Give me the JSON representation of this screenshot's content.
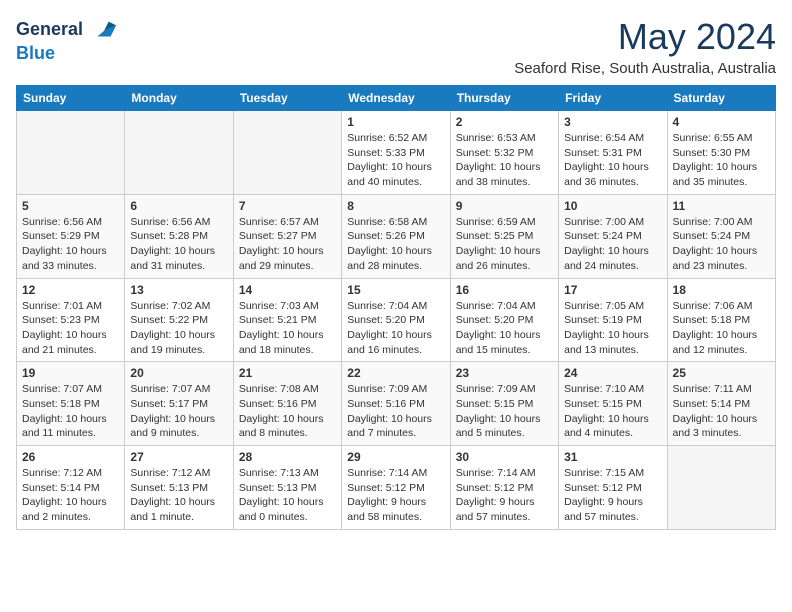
{
  "logo": {
    "line1": "General",
    "line2": "Blue"
  },
  "header": {
    "month_year": "May 2024",
    "location": "Seaford Rise, South Australia, Australia"
  },
  "days_of_week": [
    "Sunday",
    "Monday",
    "Tuesday",
    "Wednesday",
    "Thursday",
    "Friday",
    "Saturday"
  ],
  "weeks": [
    [
      {
        "day": "",
        "info": ""
      },
      {
        "day": "",
        "info": ""
      },
      {
        "day": "",
        "info": ""
      },
      {
        "day": "1",
        "info": "Sunrise: 6:52 AM\nSunset: 5:33 PM\nDaylight: 10 hours\nand 40 minutes."
      },
      {
        "day": "2",
        "info": "Sunrise: 6:53 AM\nSunset: 5:32 PM\nDaylight: 10 hours\nand 38 minutes."
      },
      {
        "day": "3",
        "info": "Sunrise: 6:54 AM\nSunset: 5:31 PM\nDaylight: 10 hours\nand 36 minutes."
      },
      {
        "day": "4",
        "info": "Sunrise: 6:55 AM\nSunset: 5:30 PM\nDaylight: 10 hours\nand 35 minutes."
      }
    ],
    [
      {
        "day": "5",
        "info": "Sunrise: 6:56 AM\nSunset: 5:29 PM\nDaylight: 10 hours\nand 33 minutes."
      },
      {
        "day": "6",
        "info": "Sunrise: 6:56 AM\nSunset: 5:28 PM\nDaylight: 10 hours\nand 31 minutes."
      },
      {
        "day": "7",
        "info": "Sunrise: 6:57 AM\nSunset: 5:27 PM\nDaylight: 10 hours\nand 29 minutes."
      },
      {
        "day": "8",
        "info": "Sunrise: 6:58 AM\nSunset: 5:26 PM\nDaylight: 10 hours\nand 28 minutes."
      },
      {
        "day": "9",
        "info": "Sunrise: 6:59 AM\nSunset: 5:25 PM\nDaylight: 10 hours\nand 26 minutes."
      },
      {
        "day": "10",
        "info": "Sunrise: 7:00 AM\nSunset: 5:24 PM\nDaylight: 10 hours\nand 24 minutes."
      },
      {
        "day": "11",
        "info": "Sunrise: 7:00 AM\nSunset: 5:24 PM\nDaylight: 10 hours\nand 23 minutes."
      }
    ],
    [
      {
        "day": "12",
        "info": "Sunrise: 7:01 AM\nSunset: 5:23 PM\nDaylight: 10 hours\nand 21 minutes."
      },
      {
        "day": "13",
        "info": "Sunrise: 7:02 AM\nSunset: 5:22 PM\nDaylight: 10 hours\nand 19 minutes."
      },
      {
        "day": "14",
        "info": "Sunrise: 7:03 AM\nSunset: 5:21 PM\nDaylight: 10 hours\nand 18 minutes."
      },
      {
        "day": "15",
        "info": "Sunrise: 7:04 AM\nSunset: 5:20 PM\nDaylight: 10 hours\nand 16 minutes."
      },
      {
        "day": "16",
        "info": "Sunrise: 7:04 AM\nSunset: 5:20 PM\nDaylight: 10 hours\nand 15 minutes."
      },
      {
        "day": "17",
        "info": "Sunrise: 7:05 AM\nSunset: 5:19 PM\nDaylight: 10 hours\nand 13 minutes."
      },
      {
        "day": "18",
        "info": "Sunrise: 7:06 AM\nSunset: 5:18 PM\nDaylight: 10 hours\nand 12 minutes."
      }
    ],
    [
      {
        "day": "19",
        "info": "Sunrise: 7:07 AM\nSunset: 5:18 PM\nDaylight: 10 hours\nand 11 minutes."
      },
      {
        "day": "20",
        "info": "Sunrise: 7:07 AM\nSunset: 5:17 PM\nDaylight: 10 hours\nand 9 minutes."
      },
      {
        "day": "21",
        "info": "Sunrise: 7:08 AM\nSunset: 5:16 PM\nDaylight: 10 hours\nand 8 minutes."
      },
      {
        "day": "22",
        "info": "Sunrise: 7:09 AM\nSunset: 5:16 PM\nDaylight: 10 hours\nand 7 minutes."
      },
      {
        "day": "23",
        "info": "Sunrise: 7:09 AM\nSunset: 5:15 PM\nDaylight: 10 hours\nand 5 minutes."
      },
      {
        "day": "24",
        "info": "Sunrise: 7:10 AM\nSunset: 5:15 PM\nDaylight: 10 hours\nand 4 minutes."
      },
      {
        "day": "25",
        "info": "Sunrise: 7:11 AM\nSunset: 5:14 PM\nDaylight: 10 hours\nand 3 minutes."
      }
    ],
    [
      {
        "day": "26",
        "info": "Sunrise: 7:12 AM\nSunset: 5:14 PM\nDaylight: 10 hours\nand 2 minutes."
      },
      {
        "day": "27",
        "info": "Sunrise: 7:12 AM\nSunset: 5:13 PM\nDaylight: 10 hours\nand 1 minute."
      },
      {
        "day": "28",
        "info": "Sunrise: 7:13 AM\nSunset: 5:13 PM\nDaylight: 10 hours\nand 0 minutes."
      },
      {
        "day": "29",
        "info": "Sunrise: 7:14 AM\nSunset: 5:12 PM\nDaylight: 9 hours\nand 58 minutes."
      },
      {
        "day": "30",
        "info": "Sunrise: 7:14 AM\nSunset: 5:12 PM\nDaylight: 9 hours\nand 57 minutes."
      },
      {
        "day": "31",
        "info": "Sunrise: 7:15 AM\nSunset: 5:12 PM\nDaylight: 9 hours\nand 57 minutes."
      },
      {
        "day": "",
        "info": ""
      }
    ]
  ]
}
